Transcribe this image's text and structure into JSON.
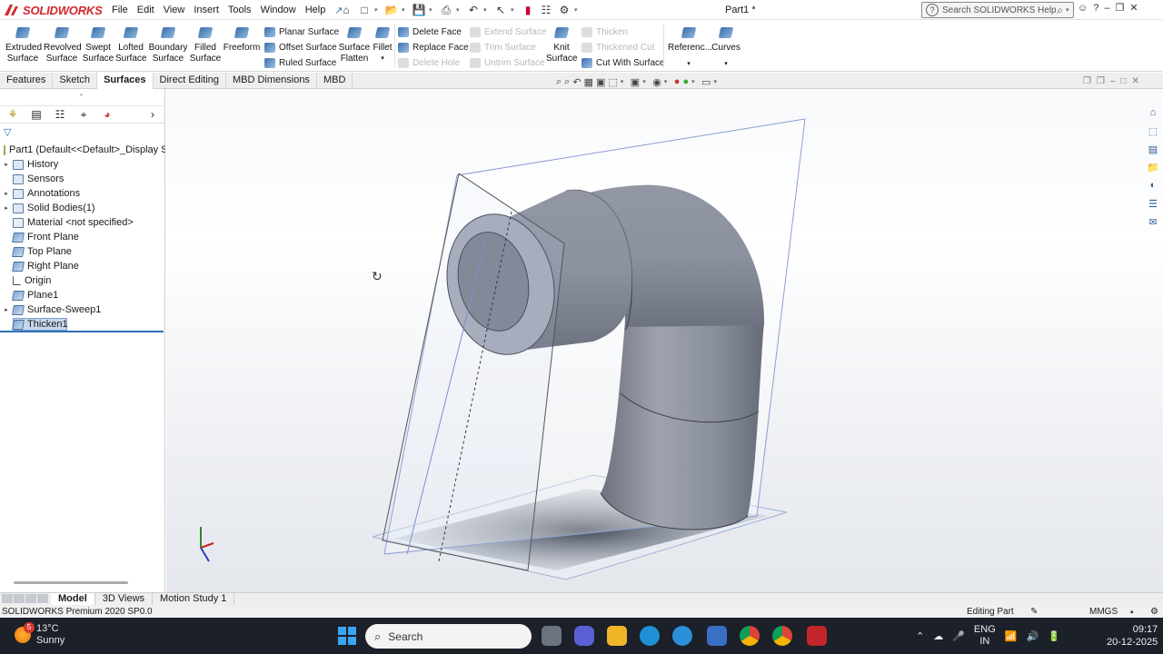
{
  "app": {
    "brand": "SOLIDWORKS",
    "document_title": "Part1 *"
  },
  "menu": [
    "File",
    "Edit",
    "View",
    "Insert",
    "Tools",
    "Window",
    "Help"
  ],
  "search": {
    "placeholder": "Search SOLIDWORKS Help"
  },
  "toolbar": {
    "big": [
      {
        "l1": "Extruded",
        "l2": "Surface"
      },
      {
        "l1": "Revolved",
        "l2": "Surface"
      },
      {
        "l1": "Swept",
        "l2": "Surface"
      },
      {
        "l1": "Lofted",
        "l2": "Surface"
      },
      {
        "l1": "Boundary",
        "l2": "Surface"
      },
      {
        "l1": "Filled",
        "l2": "Surface"
      },
      {
        "l1": "Freeform",
        "l2": ""
      }
    ],
    "col1": [
      "Planar Surface",
      "Offset Surface",
      "Ruled Surface"
    ],
    "surface_flatten": {
      "l1": "Surface",
      "l2": "Flatten"
    },
    "fillet": "Fillet",
    "col2": [
      "Delete Face",
      "Replace Face",
      "Delete Hole"
    ],
    "col3": [
      "Extend Surface",
      "Trim Surface",
      "Untrim Surface"
    ],
    "knit": {
      "l1": "Knit",
      "l2": "Surface"
    },
    "col4": [
      "Thicken",
      "Thickened Cut",
      "Cut With Surface"
    ],
    "reference": "Referenc...",
    "curves": "Curves"
  },
  "tabs": [
    "Features",
    "Sketch",
    "Surfaces",
    "Direct Editing",
    "MBD Dimensions",
    "MBD"
  ],
  "active_tab": "Surfaces",
  "tree": {
    "root": "Part1  (Default<<Default>_Display S",
    "items": [
      {
        "label": "History",
        "expand": true,
        "icon": "folder-icon"
      },
      {
        "label": "Sensors",
        "expand": false,
        "icon": "sensor-icon"
      },
      {
        "label": "Annotations",
        "expand": true,
        "icon": "annotation-icon"
      },
      {
        "label": "Solid Bodies(1)",
        "expand": true,
        "icon": "solid-bodies-icon"
      },
      {
        "label": "Material <not specified>",
        "expand": false,
        "icon": "material-icon"
      },
      {
        "label": "Front Plane",
        "expand": false,
        "icon": "plane-icon"
      },
      {
        "label": "Top Plane",
        "expand": false,
        "icon": "plane-icon"
      },
      {
        "label": "Right Plane",
        "expand": false,
        "icon": "plane-icon"
      },
      {
        "label": "Origin",
        "expand": false,
        "icon": "origin-icon"
      },
      {
        "label": "Plane1",
        "expand": false,
        "icon": "plane-icon"
      },
      {
        "label": "Surface-Sweep1",
        "expand": true,
        "icon": "sweep-icon"
      },
      {
        "label": "Thicken1",
        "expand": false,
        "icon": "thicken-icon"
      }
    ]
  },
  "bottom_tabs": [
    "Model",
    "3D Views",
    "Motion Study 1"
  ],
  "status": {
    "version": "SOLIDWORKS Premium 2020 SP0.0",
    "mode": "Editing Part",
    "units": "MMGS"
  },
  "taskbar": {
    "temp": "13°C",
    "weather": "Sunny",
    "badge": "5",
    "search": "Search",
    "lang1": "ENG",
    "lang2": "IN",
    "time": "09:17",
    "date": "20-12-2025"
  },
  "colors": {
    "accent": "#d4252b",
    "selection": "#2e6fb7",
    "part": "#8a8f9c"
  }
}
